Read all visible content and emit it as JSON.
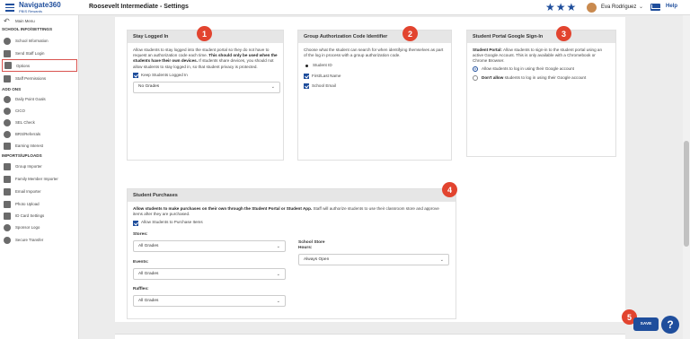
{
  "app": {
    "brand_name": "Navigate360",
    "brand_sub": "PBIS Rewards",
    "page_title": "Roosevelt Intermediate - Settings",
    "stars": "★★★",
    "user_name": "Eva Rodriguez",
    "user_caret": "⌄",
    "help_label": "Help",
    "accent_color": "#1f4e9c",
    "badge_color": "#e2442f"
  },
  "sidebar": {
    "main_menu": "Main Menu",
    "section_school_info": "SCHOOL INFO/SETTINGS",
    "school_info_items": [
      {
        "label": "School Information",
        "icon": "info-icon"
      },
      {
        "label": "Send Staff Login",
        "icon": "send-icon"
      },
      {
        "label": "Options",
        "icon": "checkbox-icon"
      },
      {
        "label": "Staff Permissions",
        "icon": "key-icon"
      }
    ],
    "section_add_ons": "ADD ONS",
    "add_on_items": [
      {
        "label": "Daily Point Goals",
        "icon": "target-icon"
      },
      {
        "label": "CICO",
        "icon": "check-circle-icon"
      },
      {
        "label": "SEL Check",
        "icon": "heart-icon"
      },
      {
        "label": "BRS/Referrals",
        "icon": "record-icon"
      },
      {
        "label": "Earning Interest",
        "icon": "trophy-icon"
      }
    ],
    "section_imports": "IMPORTS/UPLOADS",
    "import_items": [
      {
        "label": "Group Importer",
        "icon": "group-icon"
      },
      {
        "label": "Family Member Importer",
        "icon": "family-icon"
      },
      {
        "label": "Email Importer",
        "icon": "email-icon"
      },
      {
        "label": "Photo Upload",
        "icon": "photo-icon"
      },
      {
        "label": "ID Card Settings",
        "icon": "id-card-icon"
      },
      {
        "label": "Sponsor Logo",
        "icon": "logo-icon"
      },
      {
        "label": "Secure Transfer",
        "icon": "transfer-icon"
      }
    ]
  },
  "stay_logged_in": {
    "title": "Stay Logged In",
    "text_1": "Allow students to stay logged into the student portal so they do not have to request an authorization code each time.",
    "text_bold": "This should only be used when the students have their own devices.",
    "text_2": "If students share devices, you should not allow students to stay logged in, so that student privacy is protected.",
    "checkbox_label": "Keep Students Logged In",
    "select_value": "No Grades"
  },
  "group_auth": {
    "title": "Group Authorization Code Identifier",
    "description": "Choose what the student can search for when identifying themselves as part of the log in process with a group authorization code.",
    "options": [
      "Student ID",
      "First/Last Name",
      "School Email"
    ]
  },
  "google_signin": {
    "title": "Student Portal Google Sign-In",
    "desc_bold": "Student Portal:",
    "desc": "Allow students to sign-in to the student portal using an active Google Account. This is only available with a Chromebook or Chrome Browser.",
    "option_allow": "Allow students to log in using their Google account",
    "option_deny_bold": "Don't allow",
    "option_deny_rest": "students to log in using their Google account"
  },
  "purchases": {
    "title": "Student Purchases",
    "desc_bold": "Allow students to make purchases on their own through the Student Portal or Student App.",
    "desc": "Staff will authorize students to use their classroom store and approve items after they are purchased.",
    "checkbox_label": "Allow Students to Purchase Items",
    "stores_label": "Stores:",
    "stores_value": "All Grades",
    "events_label": "Events:",
    "events_value": "All Grades",
    "raffles_label": "Raffles:",
    "raffles_value": "All Grades",
    "store_hours_label_1": "School Store",
    "store_hours_label_2": "Hours:",
    "store_hours_value": "Always Open"
  },
  "badges": [
    "1",
    "2",
    "3",
    "4",
    "5"
  ],
  "save_label": "SAVE",
  "help_fab": "?"
}
